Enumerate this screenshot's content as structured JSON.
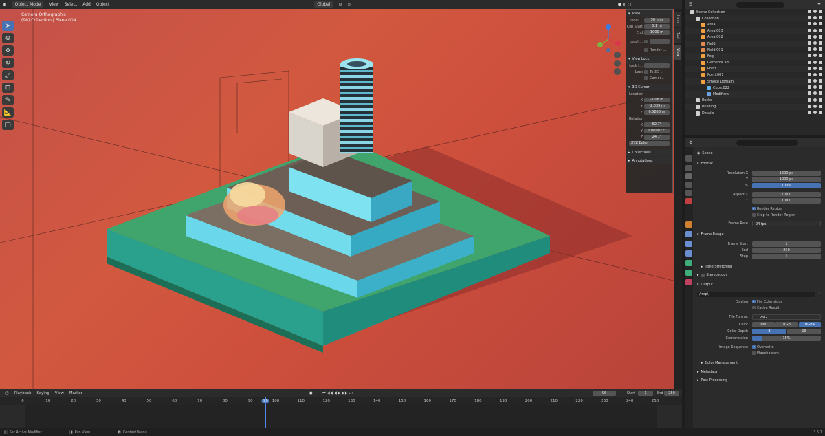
{
  "viewport_header": {
    "mode": "Object Mode",
    "menus": [
      "View",
      "Select",
      "Add",
      "Object"
    ],
    "orientation": "Global"
  },
  "viewport_info": {
    "line1": "Camera Orthographic",
    "line2": "(96) Collection | Plane.004"
  },
  "npanel": {
    "tabs": [
      "Item",
      "Tool",
      "View"
    ],
    "view": {
      "title": "View",
      "focal_label": "Focal ...",
      "focal_value": "50 mm",
      "clip_start_label": "Clip Start",
      "clip_start": "0.1 m",
      "clip_end_label": "End",
      "clip_end": "1000 m",
      "local_cam_label": "Local ...",
      "render_region": "Render ..."
    },
    "view_lock": {
      "title": "View Lock",
      "lock_to_obj": "Lock t...",
      "lock_label": "Lock",
      "to_3d": "To 3D ...",
      "camera": "Camer..."
    },
    "cursor": {
      "title": "3D Cursor",
      "location_label": "Location",
      "x": "-1.08 m",
      "y": "-2.039 m",
      "z": "0.5853 m",
      "rotation_label": "Rotation",
      "rx": "62.7°",
      "ry": "0.000022°",
      "rz": "24.1°",
      "mode": "XYZ Euler"
    },
    "collections": "Collections",
    "annotations": "Annotations"
  },
  "timeline": {
    "menus": [
      "Playback",
      "Keying",
      "View",
      "Marker"
    ],
    "current_frame": "96",
    "start_label": "Start",
    "start": "1",
    "end_label": "End",
    "end": "250",
    "ticks": [
      "0",
      "10",
      "20",
      "30",
      "40",
      "50",
      "60",
      "70",
      "80",
      "90",
      "96",
      "100",
      "110",
      "120",
      "130",
      "140",
      "150",
      "160",
      "170",
      "180",
      "190",
      "200",
      "210",
      "220",
      "230",
      "240",
      "250"
    ]
  },
  "status_bar": {
    "item1": "Set Active Modifier",
    "item2": "Pan View",
    "item3": "Context Menu",
    "version": "3.5.1"
  },
  "outliner": {
    "rows": [
      {
        "label": "Scene Collection",
        "indent": 0,
        "color": "#cfcfcf"
      },
      {
        "label": "Collection",
        "indent": 1,
        "color": "#cfcfcf"
      },
      {
        "label": "Area",
        "indent": 2,
        "color": "#f0a040"
      },
      {
        "label": "Area.003",
        "indent": 2,
        "color": "#f0a040"
      },
      {
        "label": "Area.002",
        "indent": 2,
        "color": "#f0a040"
      },
      {
        "label": "Field",
        "indent": 2,
        "color": "#e08a50"
      },
      {
        "label": "Field.001",
        "indent": 2,
        "color": "#e08a50"
      },
      {
        "label": "Fog",
        "indent": 2,
        "color": "#f0a040"
      },
      {
        "label": "GameboCam",
        "indent": 2,
        "color": "#f0a040"
      },
      {
        "label": "Point",
        "indent": 2,
        "color": "#f0a040"
      },
      {
        "label": "Point.001",
        "indent": 2,
        "color": "#f0a040"
      },
      {
        "label": "Smoke Domain",
        "indent": 2,
        "color": "#f0a040"
      },
      {
        "label": "Cube.022",
        "indent": 3,
        "color": "#66b3e6"
      },
      {
        "label": "Modifiers",
        "indent": 3,
        "color": "#6fa0e0"
      },
      {
        "label": "Rocks",
        "indent": 1,
        "color": "#cfcfcf"
      },
      {
        "label": "Building",
        "indent": 1,
        "color": "#cfcfcf"
      },
      {
        "label": "Details",
        "indent": 1,
        "color": "#cfcfcf"
      }
    ]
  },
  "properties": {
    "scene": "Scene",
    "format": {
      "title": "Format",
      "res_x_label": "Resolution X",
      "res_x": "1600 px",
      "res_y_label": "Y",
      "res_y": "1200 px",
      "res_pct_label": "%",
      "res_pct": "100%",
      "aspect_x_label": "Aspect X",
      "aspect_x": "1.000",
      "aspect_y_label": "Y",
      "aspect_y": "1.000",
      "render_region": "Render Region",
      "crop": "Crop to Render Region",
      "frame_rate_label": "Frame Rate",
      "frame_rate": "24 fps"
    },
    "frame_range": {
      "title": "Frame Range",
      "start_label": "Frame Start",
      "start": "1",
      "end_label": "End",
      "end": "250",
      "step_label": "Step",
      "step": "1",
      "time_stretching": "Time Stretching"
    },
    "stereoscopy": "Stereoscopy",
    "output": {
      "title": "Output",
      "path": "/tmp\\",
      "saving_label": "Saving",
      "file_ext": "File Extensions",
      "cache_result": "Cache Result",
      "file_format_label": "File Format",
      "file_format": "PNG",
      "color_label": "Color",
      "color_options": [
        "BW",
        "RGB",
        "RGBA"
      ],
      "depth_label": "Color Depth",
      "depth_options": [
        "8",
        "16"
      ],
      "compression_label": "Compression",
      "compression": "15%",
      "image_seq_label": "Image Sequence",
      "overwrite": "Overwrite",
      "placeholders": "Placeholders",
      "color_management": "Color Management"
    },
    "metadata": "Metadata",
    "post_processing": "Post Processing"
  }
}
